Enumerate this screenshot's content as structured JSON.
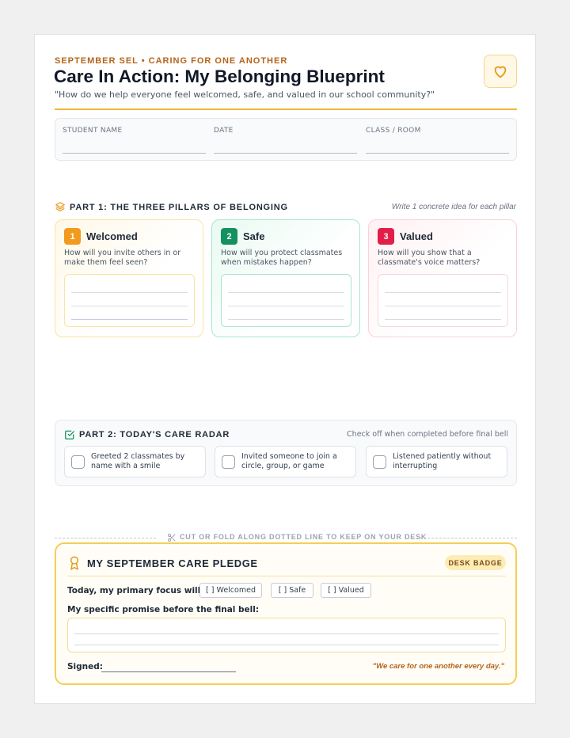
{
  "header": {
    "eyebrow": "SEPTEMBER SEL • CARING FOR ONE ANOTHER",
    "title": "Care In Action: My Belonging Blueprint",
    "subtitle": "\"How do we help everyone feel welcomed, safe, and valued in our school community?\"",
    "icon": "heart-icon"
  },
  "student_info": {
    "fields": [
      {
        "label": "STUDENT NAME"
      },
      {
        "label": "DATE"
      },
      {
        "label": "CLASS / ROOM"
      }
    ]
  },
  "part1": {
    "heading": "PART 1: THE THREE PILLARS OF BELONGING",
    "note": "Write 1 concrete idea for each pillar",
    "icon": "layers-icon",
    "pillars": [
      {
        "number": "1",
        "title": "Welcomed",
        "question": "How will you invite others in or make them feel seen?",
        "color": "#f29a1d"
      },
      {
        "number": "2",
        "title": "Safe",
        "question": "How will you protect classmates when mistakes happen?",
        "color": "#14915f"
      },
      {
        "number": "3",
        "title": "Valued",
        "question": "How will you show that a classmate's voice matters?",
        "color": "#e11d48"
      }
    ]
  },
  "part2": {
    "heading": "PART 2: TODAY'S CARE RADAR",
    "note": "Check off when completed before final bell",
    "icon": "checkbox-icon",
    "items": [
      {
        "text": "Greeted 2 classmates by name with a smile",
        "checked": false
      },
      {
        "text": "Invited someone to join a circle, group, or game",
        "checked": false
      },
      {
        "text": "Listened patiently without interrupting",
        "checked": false
      }
    ]
  },
  "cut_line": {
    "text": "CUT OR FOLD ALONG DOTTED LINE TO KEEP ON YOUR DESK",
    "icon": "scissors-icon"
  },
  "pledge": {
    "title": "MY SEPTEMBER CARE PLEDGE",
    "badge": "DESK BADGE",
    "icon": "award-icon",
    "focus_label": "Today, my primary focus will be:",
    "focus_options": [
      "[  ] Welcomed",
      "[  ] Safe",
      "[  ] Valued"
    ],
    "promise_label": "My specific promise before the final bell:",
    "signed_label": "Signed:",
    "motto": "\"We care for one another every day.\""
  },
  "colors": {
    "accent": "#f1b73a",
    "eyebrow": "#b4641a",
    "welcomed": "#f29a1d",
    "safe": "#14915f",
    "valued": "#e11d48"
  }
}
